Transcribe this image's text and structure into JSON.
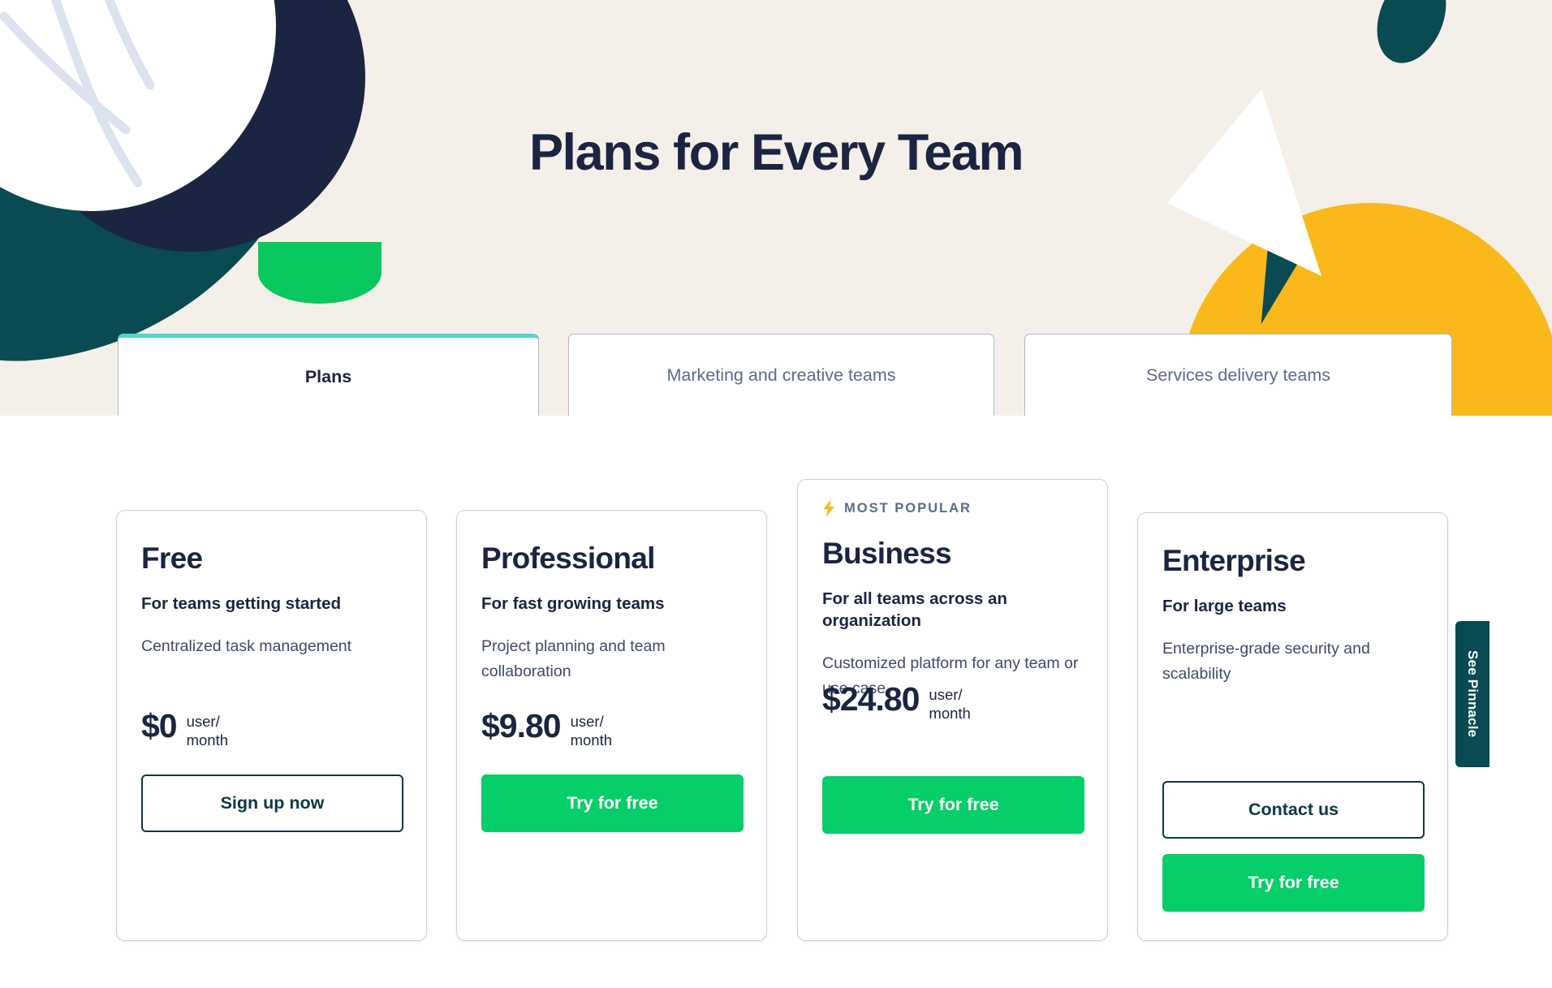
{
  "header": {
    "title": "Plans for Every Team"
  },
  "tabs": [
    {
      "label": "Plans",
      "active": true
    },
    {
      "label": "Marketing and creative teams",
      "active": false
    },
    {
      "label": "Services delivery teams",
      "active": false
    }
  ],
  "plans": [
    {
      "name": "Free",
      "tagline": "For teams getting started",
      "description": "Centralized task management",
      "price": "$0",
      "price_unit": "user/\nmonth",
      "cta": "Sign up now",
      "cta_style": "outline-dark",
      "badge": null
    },
    {
      "name": "Professional",
      "tagline": "For fast growing teams",
      "description": "Project planning and team collaboration",
      "price": "$9.80",
      "price_unit": "user/\nmonth",
      "cta": "Try for free",
      "cta_style": "green",
      "badge": null
    },
    {
      "name": "Business",
      "tagline": "For all teams across an organization",
      "description": "Customized platform for any team or use case",
      "price": "$24.80",
      "price_unit": "user/\nmonth",
      "cta": "Try for free",
      "cta_style": "green",
      "badge": {
        "label": "MOST POPULAR",
        "icon": "lightning-bolt-icon"
      }
    },
    {
      "name": "Enterprise",
      "tagline": "For large teams",
      "description": "Enterprise-grade security and scalability",
      "price": null,
      "price_unit": null,
      "cta": "Try for free",
      "cta_style": "green",
      "secondary_cta": "Contact us",
      "badge": null
    }
  ],
  "side_tab": {
    "label": "See Pinnacle"
  },
  "colors": {
    "hero_background": "#F4F0E9",
    "title_navy": "#1B2440",
    "dark_teal": "#0A4A52",
    "green": "#06CE68",
    "yellow": "#FAB81B",
    "bright_green": "#09C85E",
    "active_tab_accent": "#4ED8C8",
    "inactive_tab_text": "#5C6B8A",
    "card_border": "#C8D0DE"
  }
}
